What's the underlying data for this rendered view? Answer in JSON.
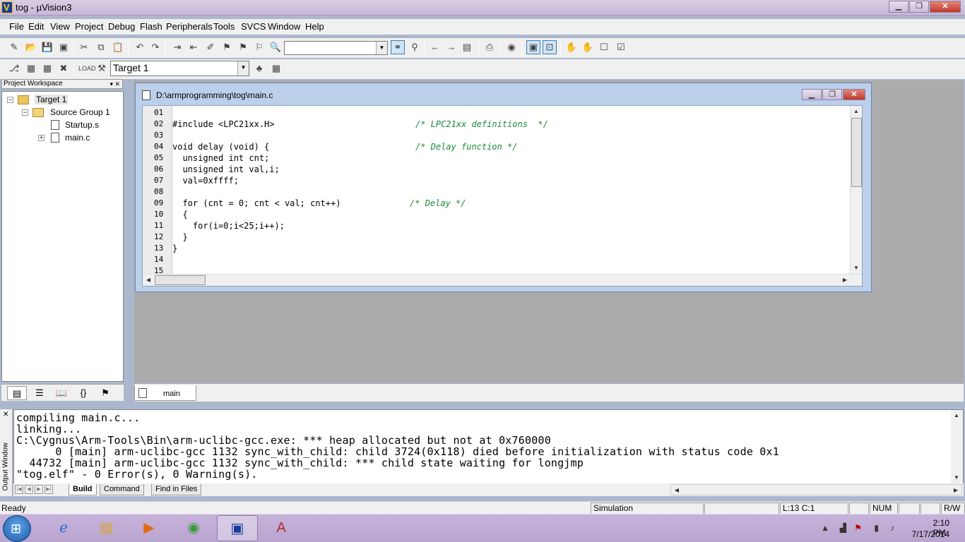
{
  "window": {
    "title": "tog  - µVision3",
    "icon_letter": "V"
  },
  "menu": [
    "File",
    "Edit",
    "View",
    "Project",
    "Debug",
    "Flash",
    "Peripherals",
    "Tools",
    "SVCS",
    "Window",
    "Help"
  ],
  "toolbar": {
    "find_combo_value": "",
    "target_combo_value": "Target 1"
  },
  "workspace": {
    "header": "Project Workspace",
    "tree": {
      "target": "Target 1",
      "group": "Source Group 1",
      "files": [
        "Startup.s",
        "main.c"
      ]
    }
  },
  "editor": {
    "title": "D:\\armprogramming\\tog\\main.c",
    "tab_label": "main",
    "line_numbers": [
      "01",
      "02",
      "03",
      "04",
      "05",
      "06",
      "07",
      "08",
      "09",
      "10",
      "11",
      "12",
      "13",
      "14",
      "15"
    ],
    "lines": [
      {
        "code": "",
        "comment": ""
      },
      {
        "code": "#include <LPC21xx.H>",
        "comment": "/* LPC21xx definitions  */"
      },
      {
        "code": "",
        "comment": ""
      },
      {
        "code": "void delay (void) {",
        "comment": "/* Delay function */"
      },
      {
        "code": "  unsigned int cnt;",
        "comment": ""
      },
      {
        "code": "  unsigned int val,i;",
        "comment": ""
      },
      {
        "code": "  val=0xffff;",
        "comment": ""
      },
      {
        "code": "",
        "comment": ""
      },
      {
        "code": "  for (cnt = 0; cnt < val; cnt++)",
        "comment": "/* Delay */"
      },
      {
        "code": "  {",
        "comment": ""
      },
      {
        "code": "    for(i=0;i<25;i++);",
        "comment": ""
      },
      {
        "code": "  }",
        "comment": ""
      },
      {
        "code": "}",
        "comment": ""
      },
      {
        "code": "",
        "comment": ""
      },
      {
        "code": "",
        "comment": ""
      }
    ]
  },
  "output": {
    "side_label": "Output Window",
    "lines": [
      "compiling main.c...",
      "linking...",
      "C:\\Cygnus\\Arm-Tools\\Bin\\arm-uclibc-gcc.exe: *** heap allocated but not at 0x760000",
      "      0 [main] arm-uclibc-gcc 1132 sync_with_child: child 3724(0x118) died before initialization with status code 0x1",
      "  44732 [main] arm-uclibc-gcc 1132 sync_with_child: *** child state waiting for longjmp",
      "\"tog.elf\" - 0 Error(s), 0 Warning(s)."
    ],
    "tabs": [
      "Build",
      "Command",
      "Find in Files"
    ]
  },
  "status": {
    "ready": "Ready",
    "mode": "Simulation",
    "position": "L:13 C:1",
    "num": "NUM",
    "rw": "R/W"
  },
  "taskbar": {
    "time": "2:10 PM",
    "date": "7/17/2014"
  },
  "colors": {
    "comment": "#1b8a3a",
    "number": "#c00000",
    "editor_frame": "#bcd0ec",
    "mdi_background": "#ababab"
  }
}
